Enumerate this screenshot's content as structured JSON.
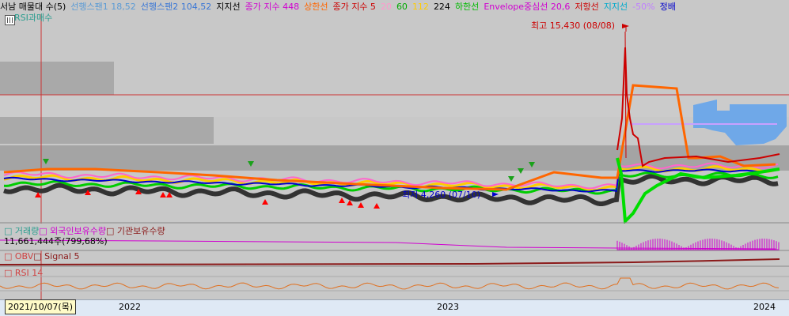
{
  "legend": {
    "items": [
      {
        "text": "서남 매물대 수(5)",
        "color": "#000000"
      },
      {
        "text": "선행스팬1 18,52",
        "color": "#5b9bd5"
      },
      {
        "text": "선행스팬2 104,52",
        "color": "#3a77d6"
      },
      {
        "text": "지지선",
        "color": "#000000"
      },
      {
        "text": "종가 지수 448",
        "color": "#d000d0"
      },
      {
        "text": "상한선",
        "color": "#ff6600"
      },
      {
        "text": "종가 지수 5",
        "color": "#cc0000"
      },
      {
        "text": "20",
        "color": "#ff99cc"
      },
      {
        "text": "60",
        "color": "#00aa00"
      },
      {
        "text": "112",
        "color": "#ffcc00"
      },
      {
        "text": "224",
        "color": "#000000"
      },
      {
        "text": "하한선",
        "color": "#00bb00"
      },
      {
        "text": "Envelope중심선 20,6",
        "color": "#d000d0"
      },
      {
        "text": "저항선",
        "color": "#cc0000"
      },
      {
        "text": "지지선",
        "color": "#00aacc"
      },
      {
        "text": "-50%",
        "color": "#c080ff"
      },
      {
        "text": "정배",
        "color": "#0000cc"
      }
    ]
  },
  "rsi_overlay_label": "RSI과매수",
  "annotations": {
    "high": "최고 15,430 (08/08)",
    "low": "최저 4,260 (07/10)"
  },
  "volume_panel": {
    "legend_items": [
      {
        "text": "거래량",
        "color": "#2a9d8f"
      },
      {
        "text": "외국인보유수량",
        "color": "#d000d0"
      },
      {
        "text": "기관보유수량",
        "color": "#8b1a1a"
      }
    ],
    "value": "11,661,444주(799,68%)"
  },
  "obv_panel": {
    "legend_items": [
      {
        "text": "OBV",
        "color": "#d04040"
      },
      {
        "text": "Signal 5",
        "color": "#8b1a1a"
      }
    ]
  },
  "rsi_panel": {
    "legend_items": [
      {
        "text": "RSI 14",
        "color": "#d04040"
      }
    ]
  },
  "xaxis": {
    "selected_date": "2021/10/07(목)",
    "ticks": [
      "2022",
      "2023",
      "2024"
    ]
  },
  "colors": {
    "background": "#c8c8c8",
    "axis_bg": "#dfe9f5",
    "resistance": "#cc0000",
    "cloud": "#6fa8e8"
  }
}
